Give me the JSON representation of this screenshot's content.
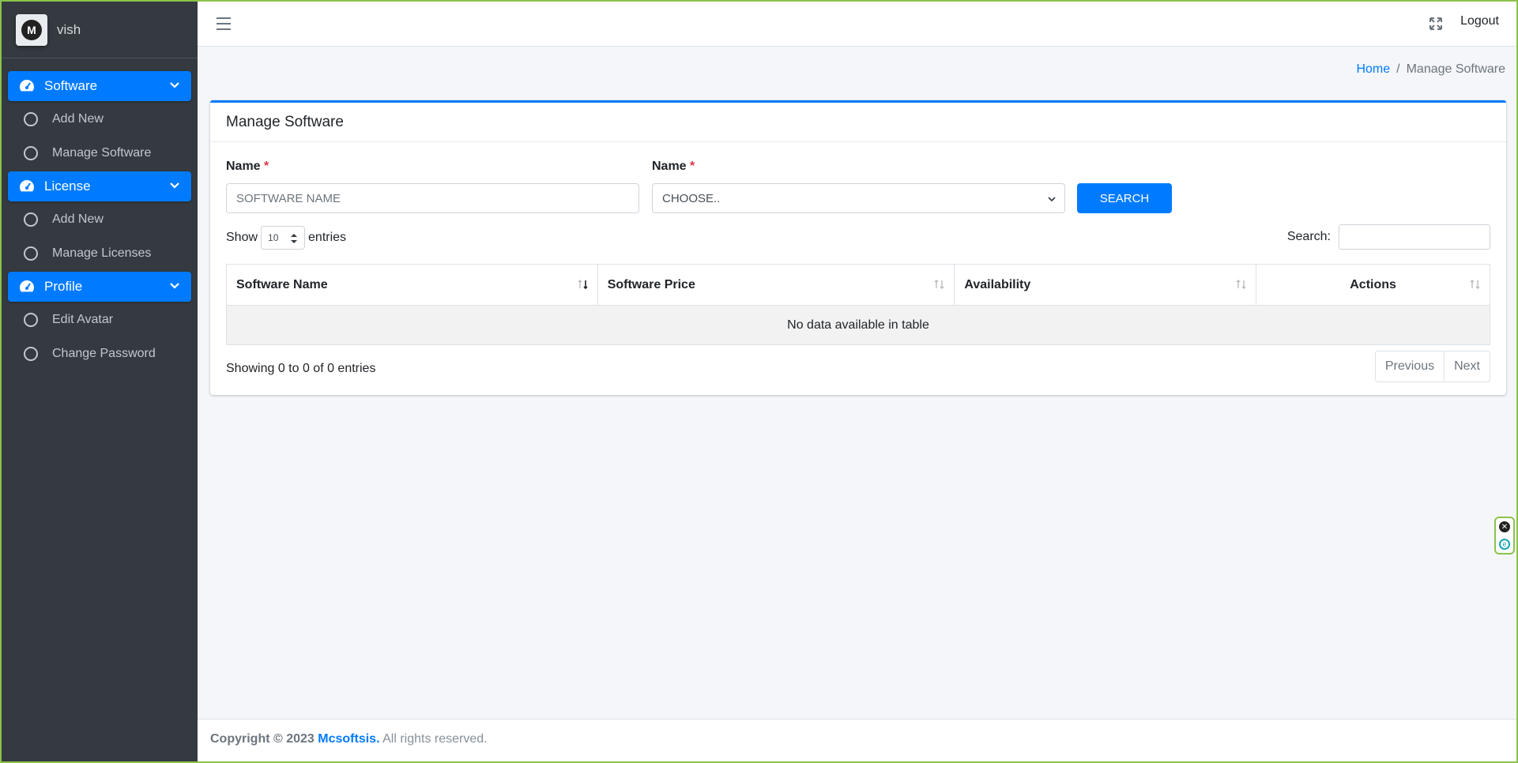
{
  "brand": {
    "logo_letter": "M",
    "username": "vish"
  },
  "sidebar": {
    "groups": [
      {
        "label": "Software",
        "items": [
          {
            "label": "Add New"
          },
          {
            "label": "Manage Software"
          }
        ]
      },
      {
        "label": "License",
        "items": [
          {
            "label": "Add New"
          },
          {
            "label": "Manage Licenses"
          }
        ]
      },
      {
        "label": "Profile",
        "items": [
          {
            "label": "Edit Avatar"
          },
          {
            "label": "Change Password"
          }
        ]
      }
    ]
  },
  "topbar": {
    "logout_label": "Logout"
  },
  "breadcrumb": {
    "home": "Home",
    "separator": "/",
    "current": "Manage Software"
  },
  "card": {
    "title": "Manage Software",
    "form": {
      "name_label": "Name",
      "required_mark": "*",
      "name_placeholder": "SOFTWARE NAME",
      "select_label": "Name",
      "select_value": "CHOOSE..",
      "search_button": "SEARCH"
    },
    "table_controls": {
      "show_label": "Show",
      "page_size": "10",
      "entries_label": "entries",
      "search_label": "Search:"
    },
    "table": {
      "columns": [
        "Software Name",
        "Software Price",
        "Availability",
        "Actions"
      ],
      "empty_message": "No data available in table"
    },
    "info": "Showing 0 to 0 of 0 entries",
    "pager": {
      "previous": "Previous",
      "next": "Next"
    }
  },
  "footer": {
    "copyright": "Copyright © 2023",
    "brand": "Mcsoftsis.",
    "rights": "All rights reserved."
  },
  "colors": {
    "primary": "#007bff",
    "sidebar_bg": "#343a40",
    "required": "#dc3545"
  }
}
